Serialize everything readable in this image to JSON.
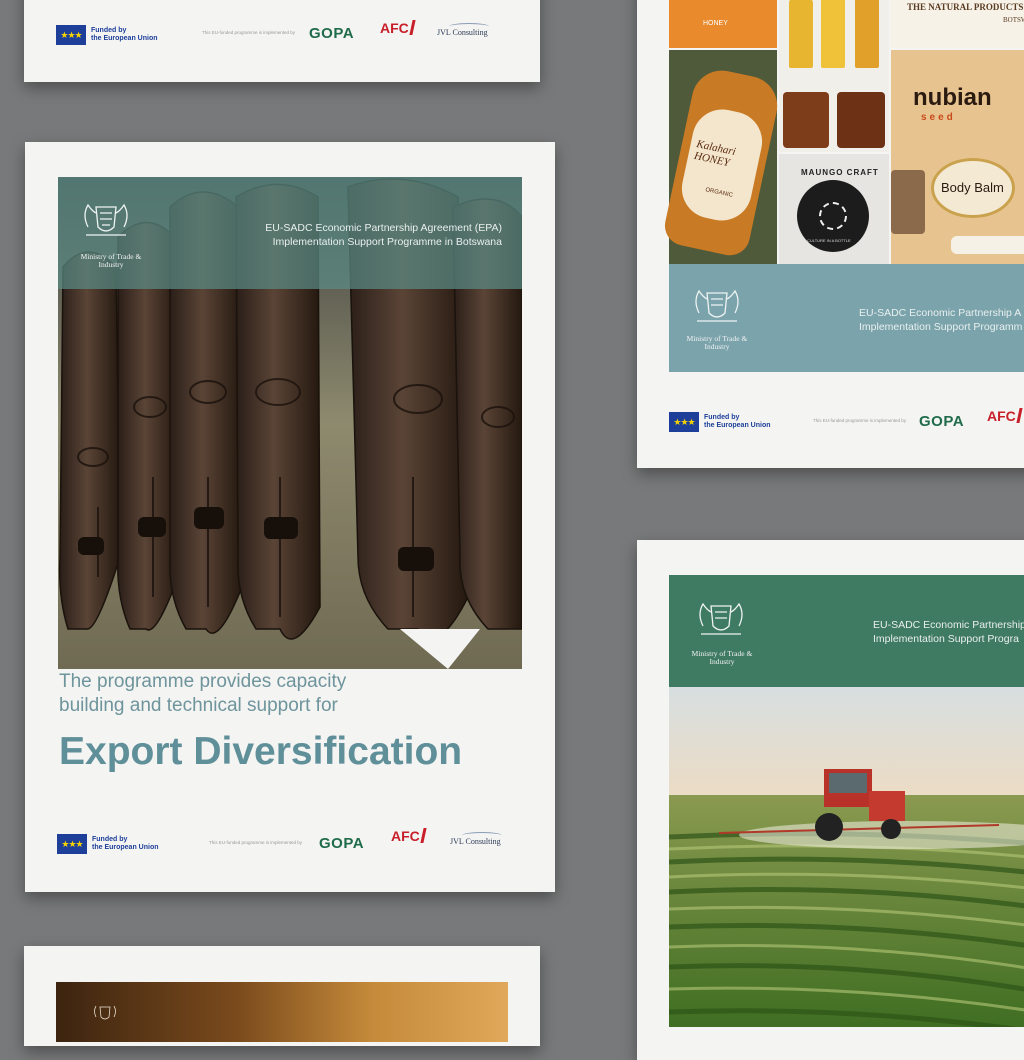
{
  "shared": {
    "eu_funded": "Funded by\nthe European Union",
    "implemented_by": "This EU-funded programme is implemented by",
    "gopa": "GOPA",
    "afc": "AFC",
    "jvl": "JVL Consulting",
    "ministry": "Ministry of Trade &\nIndustry",
    "epa_title": "EU-SADC Economic Partnership Agreement (EPA)\nImplementation Support Programme in Botswana"
  },
  "center_card": {
    "subtitle": "The programme provides capacity\nbuilding and technical support for",
    "headline": "Export Diversification",
    "colors": {
      "teal": "#6e949c",
      "headline": "#5f8f98",
      "band": "#5a8a84"
    }
  },
  "right_top_card": {
    "epa_title_partial": "EU-SADC Economic Partnership A\nImplementation Support Programm",
    "products": {
      "kalahari": "Kalahari\nHONEY",
      "organic": "ORGANIC",
      "maungo": "MAUNGO CRAFT",
      "maungo_sub": "CULTURE IN A BOTTLE",
      "nubian": "nubian",
      "nubian_sub": "seed",
      "body_balm": "Body Balm",
      "natural_products": "THE NATURAL PRODUCTS",
      "botswana": "BOTSWANA",
      "honey": "HONEY"
    },
    "colors": {
      "band": "#7aa3ac"
    }
  },
  "right_bottom_card": {
    "epa_title_partial": "EU-SADC Economic Partnership\nImplementation Support Progra",
    "colors": {
      "band": "#3f7a62"
    }
  }
}
